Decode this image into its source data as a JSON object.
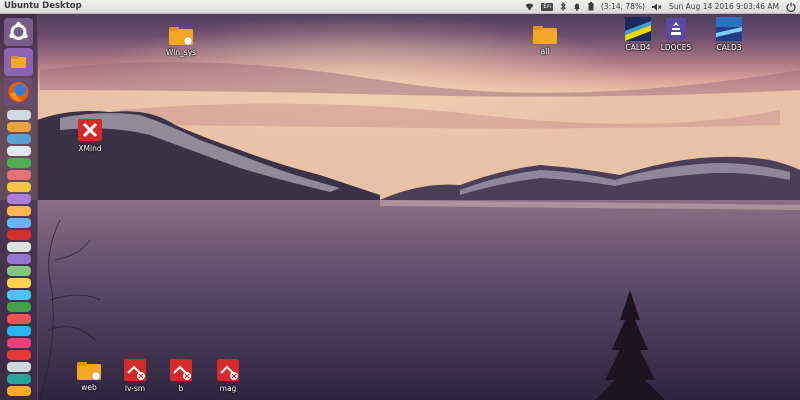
{
  "panel": {
    "title": "Ubuntu Desktop",
    "keyboard": "En",
    "battery": "(3:14, 78%)",
    "datetime": "Sun Aug 14 2016 9:03:46 AM"
  },
  "launcher": {
    "items": [
      {
        "name": "dash-home-icon",
        "color": "#6b4c7a"
      },
      {
        "name": "files-icon",
        "color": "#7b5aa0"
      },
      {
        "name": "firefox-icon",
        "color": "#d2691e"
      }
    ]
  },
  "desktop_icons": [
    {
      "id": "win-sys",
      "label": "Win_sys",
      "type": "folder"
    },
    {
      "id": "all",
      "label": "all",
      "type": "folder"
    },
    {
      "id": "cald4",
      "label": "CALD4",
      "type": "app"
    },
    {
      "id": "ldoces",
      "label": "LDOCE5",
      "type": "app"
    },
    {
      "id": "cald3",
      "label": "CALD3",
      "type": "app"
    },
    {
      "id": "xmind",
      "label": "XMind",
      "type": "app"
    },
    {
      "id": "web",
      "label": "web",
      "type": "folder"
    },
    {
      "id": "lv-sm",
      "label": "lv-sm",
      "type": "mindmap"
    },
    {
      "id": "b",
      "label": "b",
      "type": "mindmap"
    },
    {
      "id": "mag",
      "label": "mag",
      "type": "mindmap"
    }
  ],
  "colors": {
    "folder": "#f5a623",
    "xmind_red": "#d42a2a",
    "panel_bg": "#dcdad5"
  }
}
